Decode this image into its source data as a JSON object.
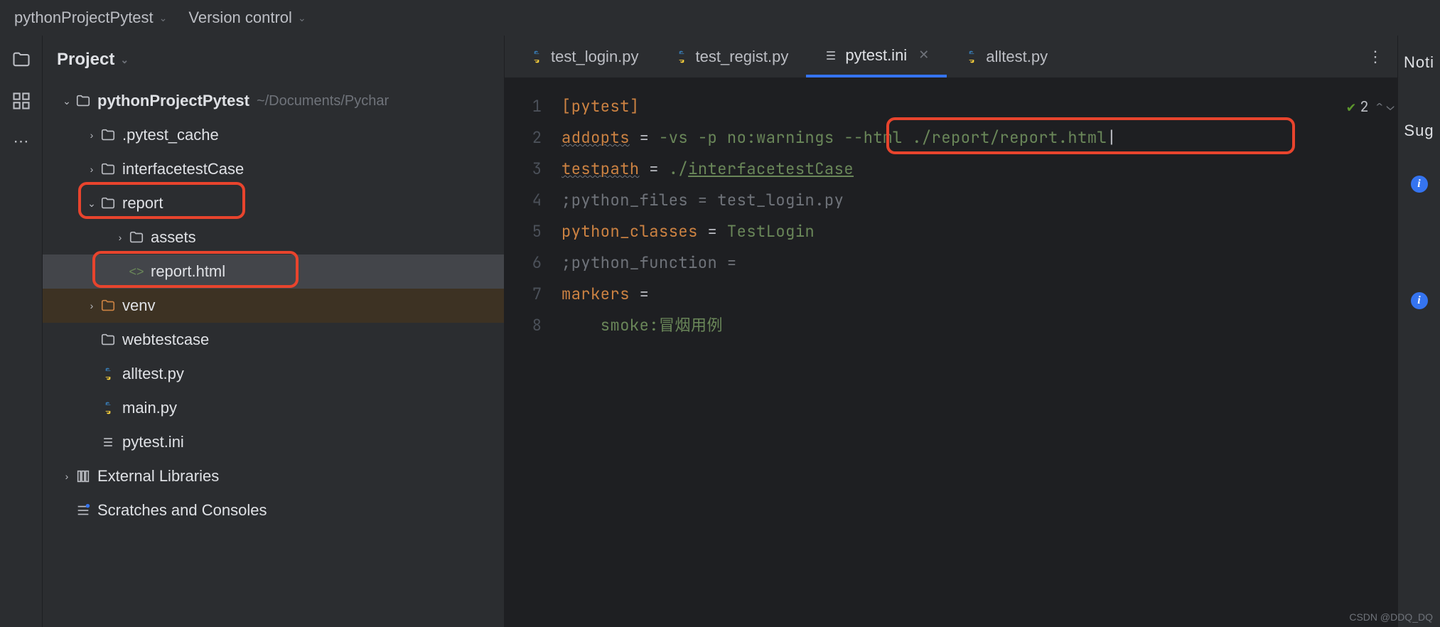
{
  "topbar": {
    "project_name": "pythonProjectPytest",
    "vcs_label": "Version control"
  },
  "sidebar": {
    "title": "Project",
    "root": {
      "name": "pythonProjectPytest",
      "path_hint": "~/Documents/Pychar"
    },
    "items": {
      "pytest_cache": ".pytest_cache",
      "interfacetestCase": "interfacetestCase",
      "report": "report",
      "assets": "assets",
      "report_html": "report.html",
      "venv": "venv",
      "webtestcase": "webtestcase",
      "alltest": "alltest.py",
      "main": "main.py",
      "pytest_ini": "pytest.ini",
      "external_libs": "External Libraries",
      "scratches": "Scratches and Consoles"
    }
  },
  "tabs": {
    "t1": "test_login.py",
    "t2": "test_regist.py",
    "t3": "pytest.ini",
    "t4": "alltest.py"
  },
  "editor": {
    "problems_count": "2",
    "lines": {
      "num1": "1",
      "num2": "2",
      "num3": "3",
      "num4": "4",
      "num5": "5",
      "num6": "6",
      "num7": "7",
      "num8": "8"
    },
    "code": {
      "l1": "[pytest]",
      "l2_k": "addopts",
      "l2_eq": " = ",
      "l2_v1": "-vs -p no:warnings",
      "l2_v2": " --html ./report/report.html",
      "l3_k": "testpath",
      "l3_eq": " = ",
      "l3_v_pre": "./",
      "l3_v_link": "interfacetestCase",
      "l4": ";python_files = test_login.py",
      "l5_k": "python_classes",
      "l5_eq": " = ",
      "l5_v": "TestLogin",
      "l6": ";python_function =",
      "l7_k": "markers",
      "l7_eq": " =",
      "l8": "    smoke:冒烟用例"
    }
  },
  "right": {
    "text1": "Noti",
    "text2": "Sug"
  },
  "watermark": "CSDN @DDQ_DQ"
}
